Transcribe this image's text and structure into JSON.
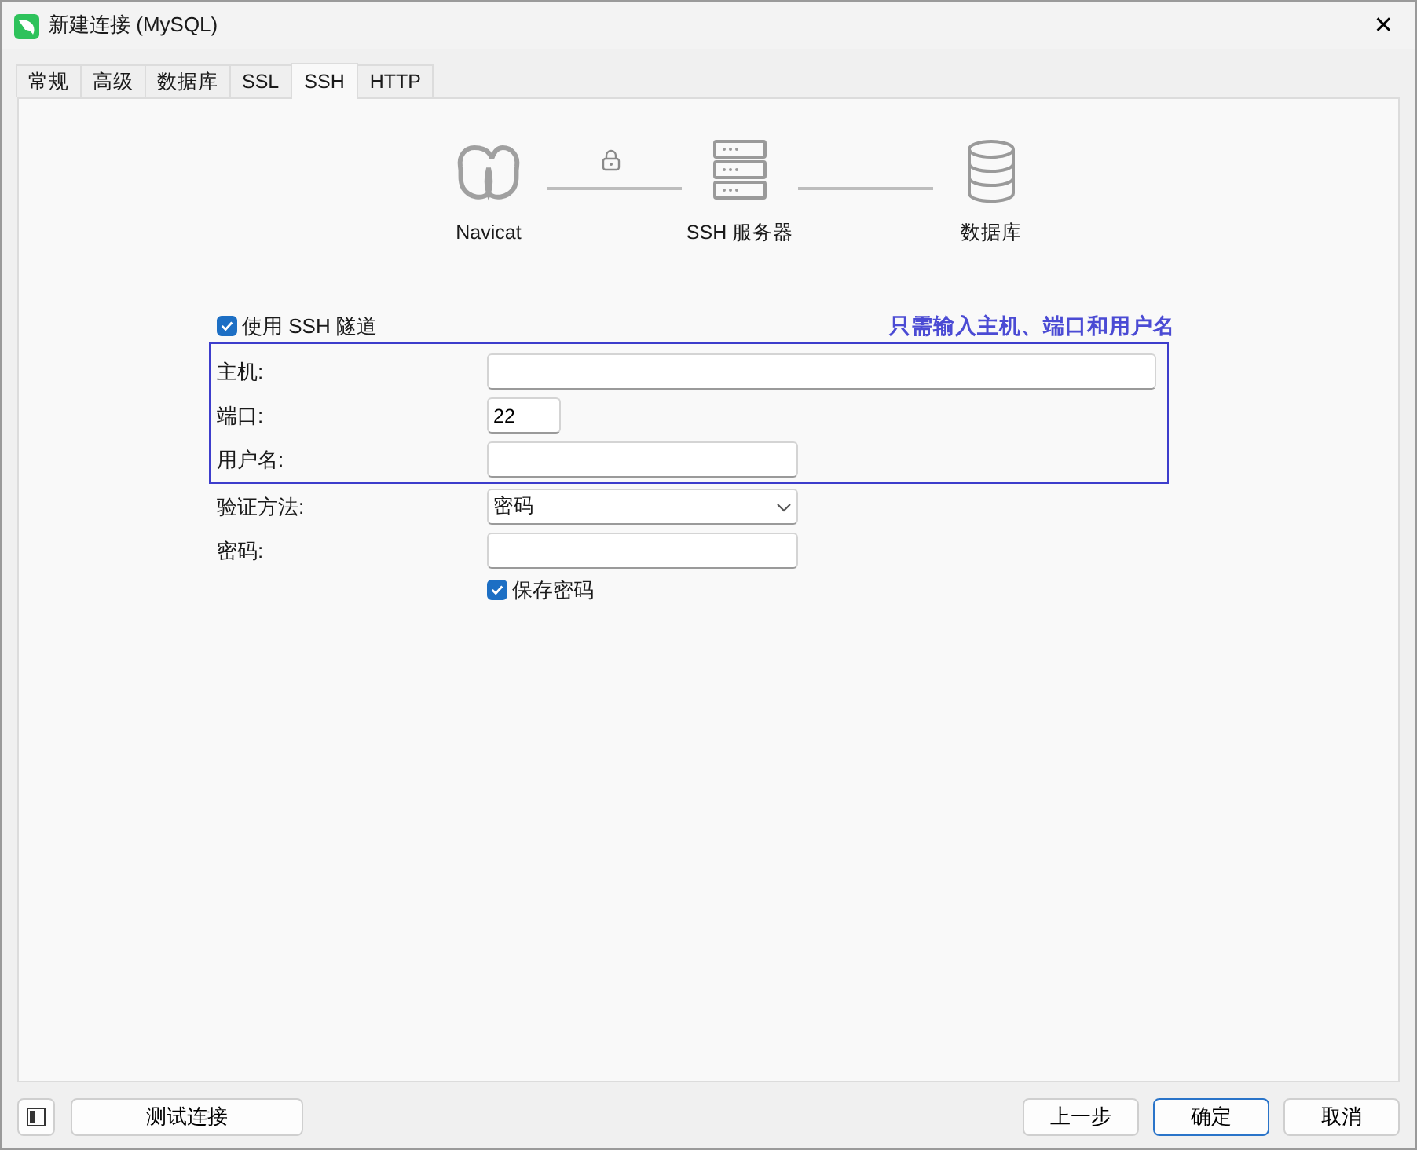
{
  "window": {
    "title": "新建连接 (MySQL)",
    "close": "✕"
  },
  "tabs": [
    {
      "label": "常规",
      "selected": false
    },
    {
      "label": "高级",
      "selected": false
    },
    {
      "label": "数据库",
      "selected": false
    },
    {
      "label": "SSL",
      "selected": false
    },
    {
      "label": "SSH",
      "selected": true
    },
    {
      "label": "HTTP",
      "selected": false
    }
  ],
  "diagram": {
    "nodes": [
      {
        "label": "Navicat",
        "kind": "navicat"
      },
      {
        "label": "SSH 服务器",
        "kind": "server"
      },
      {
        "label": "数据库",
        "kind": "database"
      }
    ],
    "links": [
      {
        "secure": true
      },
      {
        "secure": false
      }
    ]
  },
  "use_tunnel": {
    "label": "使用 SSH 隧道",
    "checked": true
  },
  "annotation": "只需输入主机、端口和用户名",
  "ssh_fields": {
    "highlighted": true,
    "fields": [
      {
        "label": "主机:",
        "kind": "text"
      },
      {
        "label": "端口:",
        "kind": "text",
        "value": "22"
      },
      {
        "label": "用户名:",
        "kind": "text"
      }
    ]
  },
  "auth_fields": [
    {
      "label": "验证方法:",
      "kind": "select",
      "value": "密码"
    },
    {
      "label": "密码:",
      "kind": "text"
    }
  ],
  "save_password": {
    "label": "保存密码",
    "checked": true
  },
  "footer": {
    "left_buttons": [
      "测试连接"
    ],
    "right_buttons": [
      {
        "label": "上一步",
        "default": false
      },
      {
        "label": "确定",
        "default": true
      },
      {
        "label": "取消",
        "default": false
      }
    ]
  }
}
